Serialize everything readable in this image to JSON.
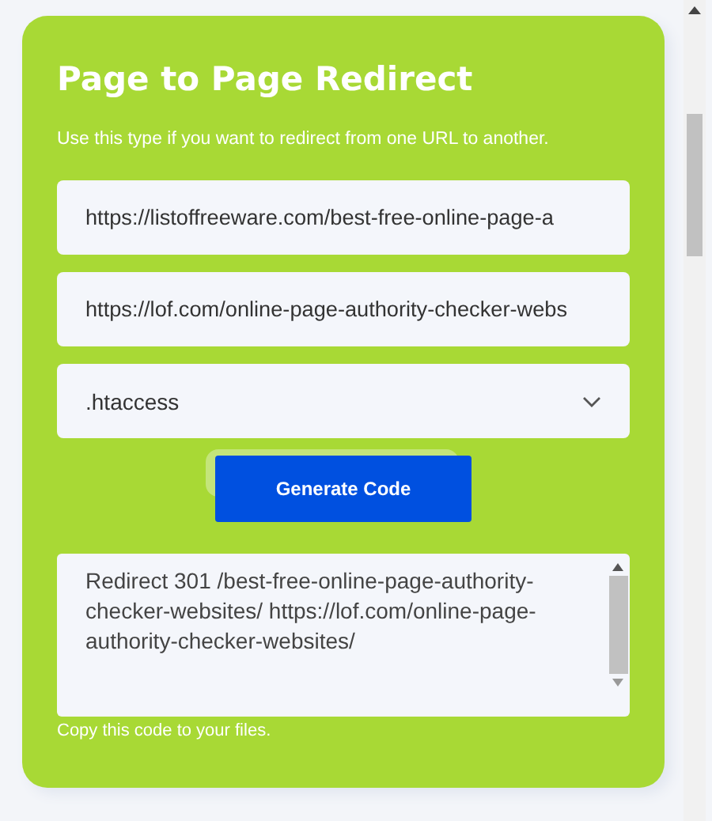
{
  "card": {
    "title": "Page to Page Redirect",
    "description": "Use this type if you want to redirect from one URL to another."
  },
  "fields": [
    {
      "kind": "input",
      "value": "https://listoffreeware.com/best-free-online-page-a"
    },
    {
      "kind": "input",
      "value": "https://lof.com/online-page-authority-checker-webs"
    },
    {
      "kind": "select",
      "value": ".htaccess"
    }
  ],
  "button": {
    "label": "Generate Code"
  },
  "output": {
    "value": "Redirect 301 /best-free-online-page-authority-checker-websites/ https://lof.com/online-page-authority-checker-websites/",
    "hint": "Copy this code to your files."
  }
}
